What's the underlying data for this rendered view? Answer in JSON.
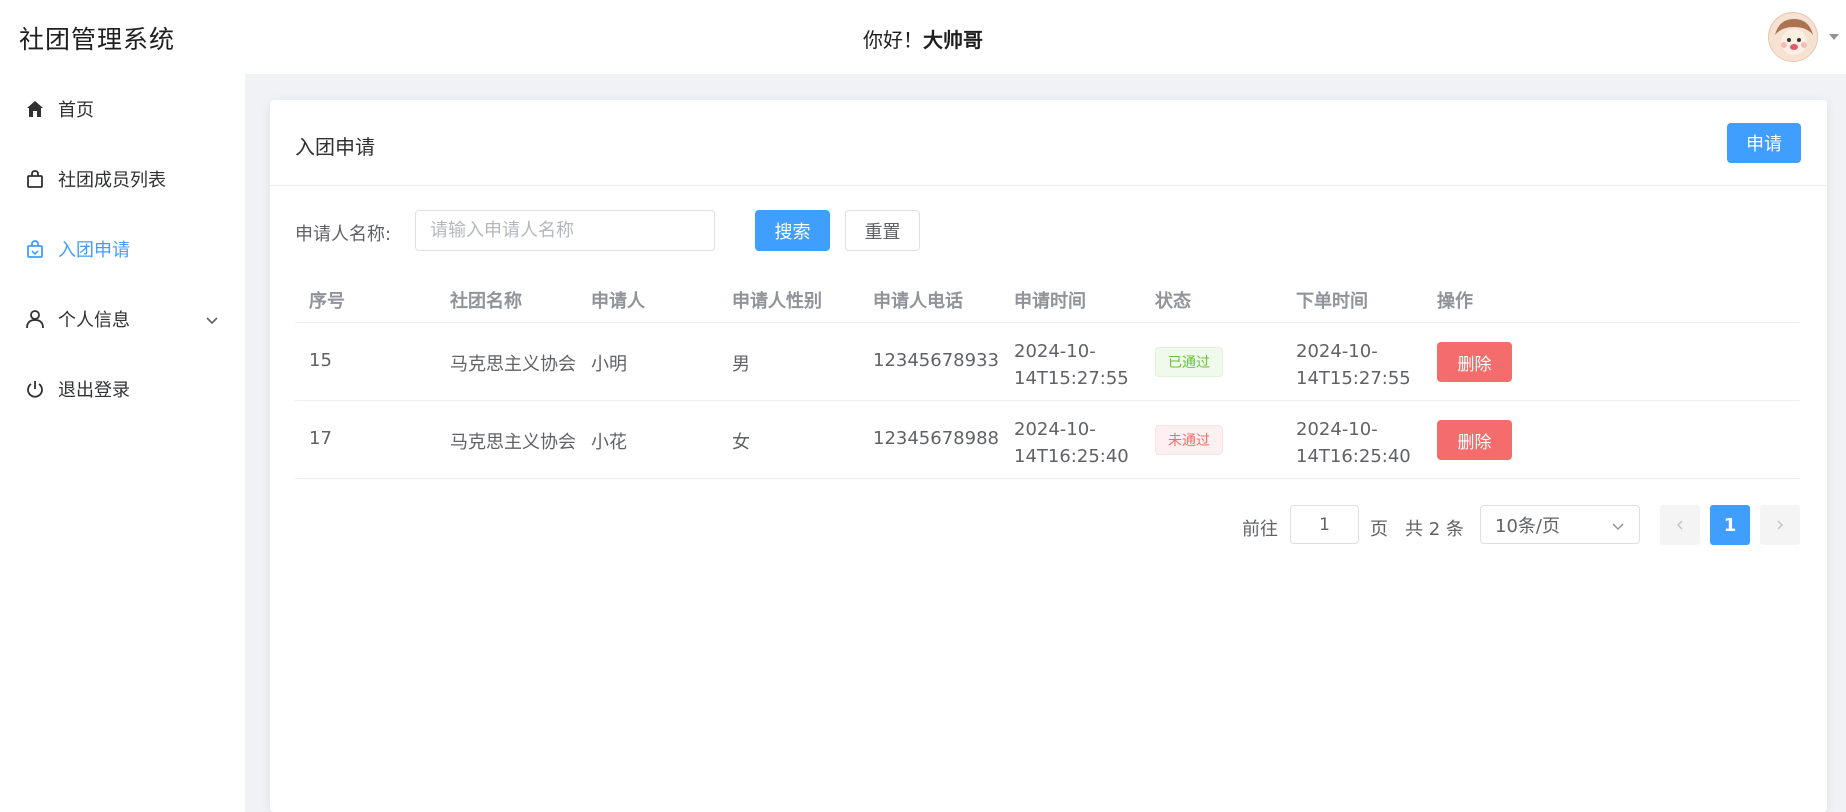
{
  "header": {
    "app_title": "社团管理系统",
    "greeting_prefix": "你好！",
    "username": "大帅哥"
  },
  "sidebar": {
    "items": [
      {
        "label": "首页",
        "icon": "home-icon"
      },
      {
        "label": "社团成员列表",
        "icon": "bag-icon"
      },
      {
        "label": "入团申请",
        "icon": "shopping-bag-icon",
        "active": true
      },
      {
        "label": "个人信息",
        "icon": "user-icon",
        "has_submenu": true
      },
      {
        "label": "退出登录",
        "icon": "power-icon"
      }
    ]
  },
  "card": {
    "title": "入团申请",
    "apply_label": "申请"
  },
  "search": {
    "label": "申请人名称:",
    "placeholder": "请输入申请人名称",
    "value": "",
    "search_label": "搜索",
    "reset_label": "重置"
  },
  "table": {
    "columns": [
      "序号",
      "社团名称",
      "申请人",
      "申请人性别",
      "申请人电话",
      "申请时间",
      "状态",
      "下单时间",
      "操作"
    ],
    "rows": [
      {
        "id": "15",
        "club": "马克思主义协会",
        "applicant": "小明",
        "gender": "男",
        "phone": "12345678933",
        "apply_time": "2024-10-14T15:27:55",
        "status": "已通过",
        "order_time": "2024-10-14T15:27:55",
        "action": "删除"
      },
      {
        "id": "17",
        "club": "马克思主义协会",
        "applicant": "小花",
        "gender": "女",
        "phone": "12345678988",
        "apply_time": "2024-10-14T16:25:40",
        "status": "未通过",
        "order_time": "2024-10-14T16:25:40",
        "action": "删除"
      }
    ]
  },
  "pagination": {
    "goto_label": "前往",
    "current_input": "1",
    "page_unit": "页",
    "total_text": "共 2 条",
    "page_size": "10条/页",
    "current_page": "1"
  },
  "colors": {
    "primary": "#409eff",
    "danger": "#f56c6c",
    "success": "#67c23a"
  }
}
